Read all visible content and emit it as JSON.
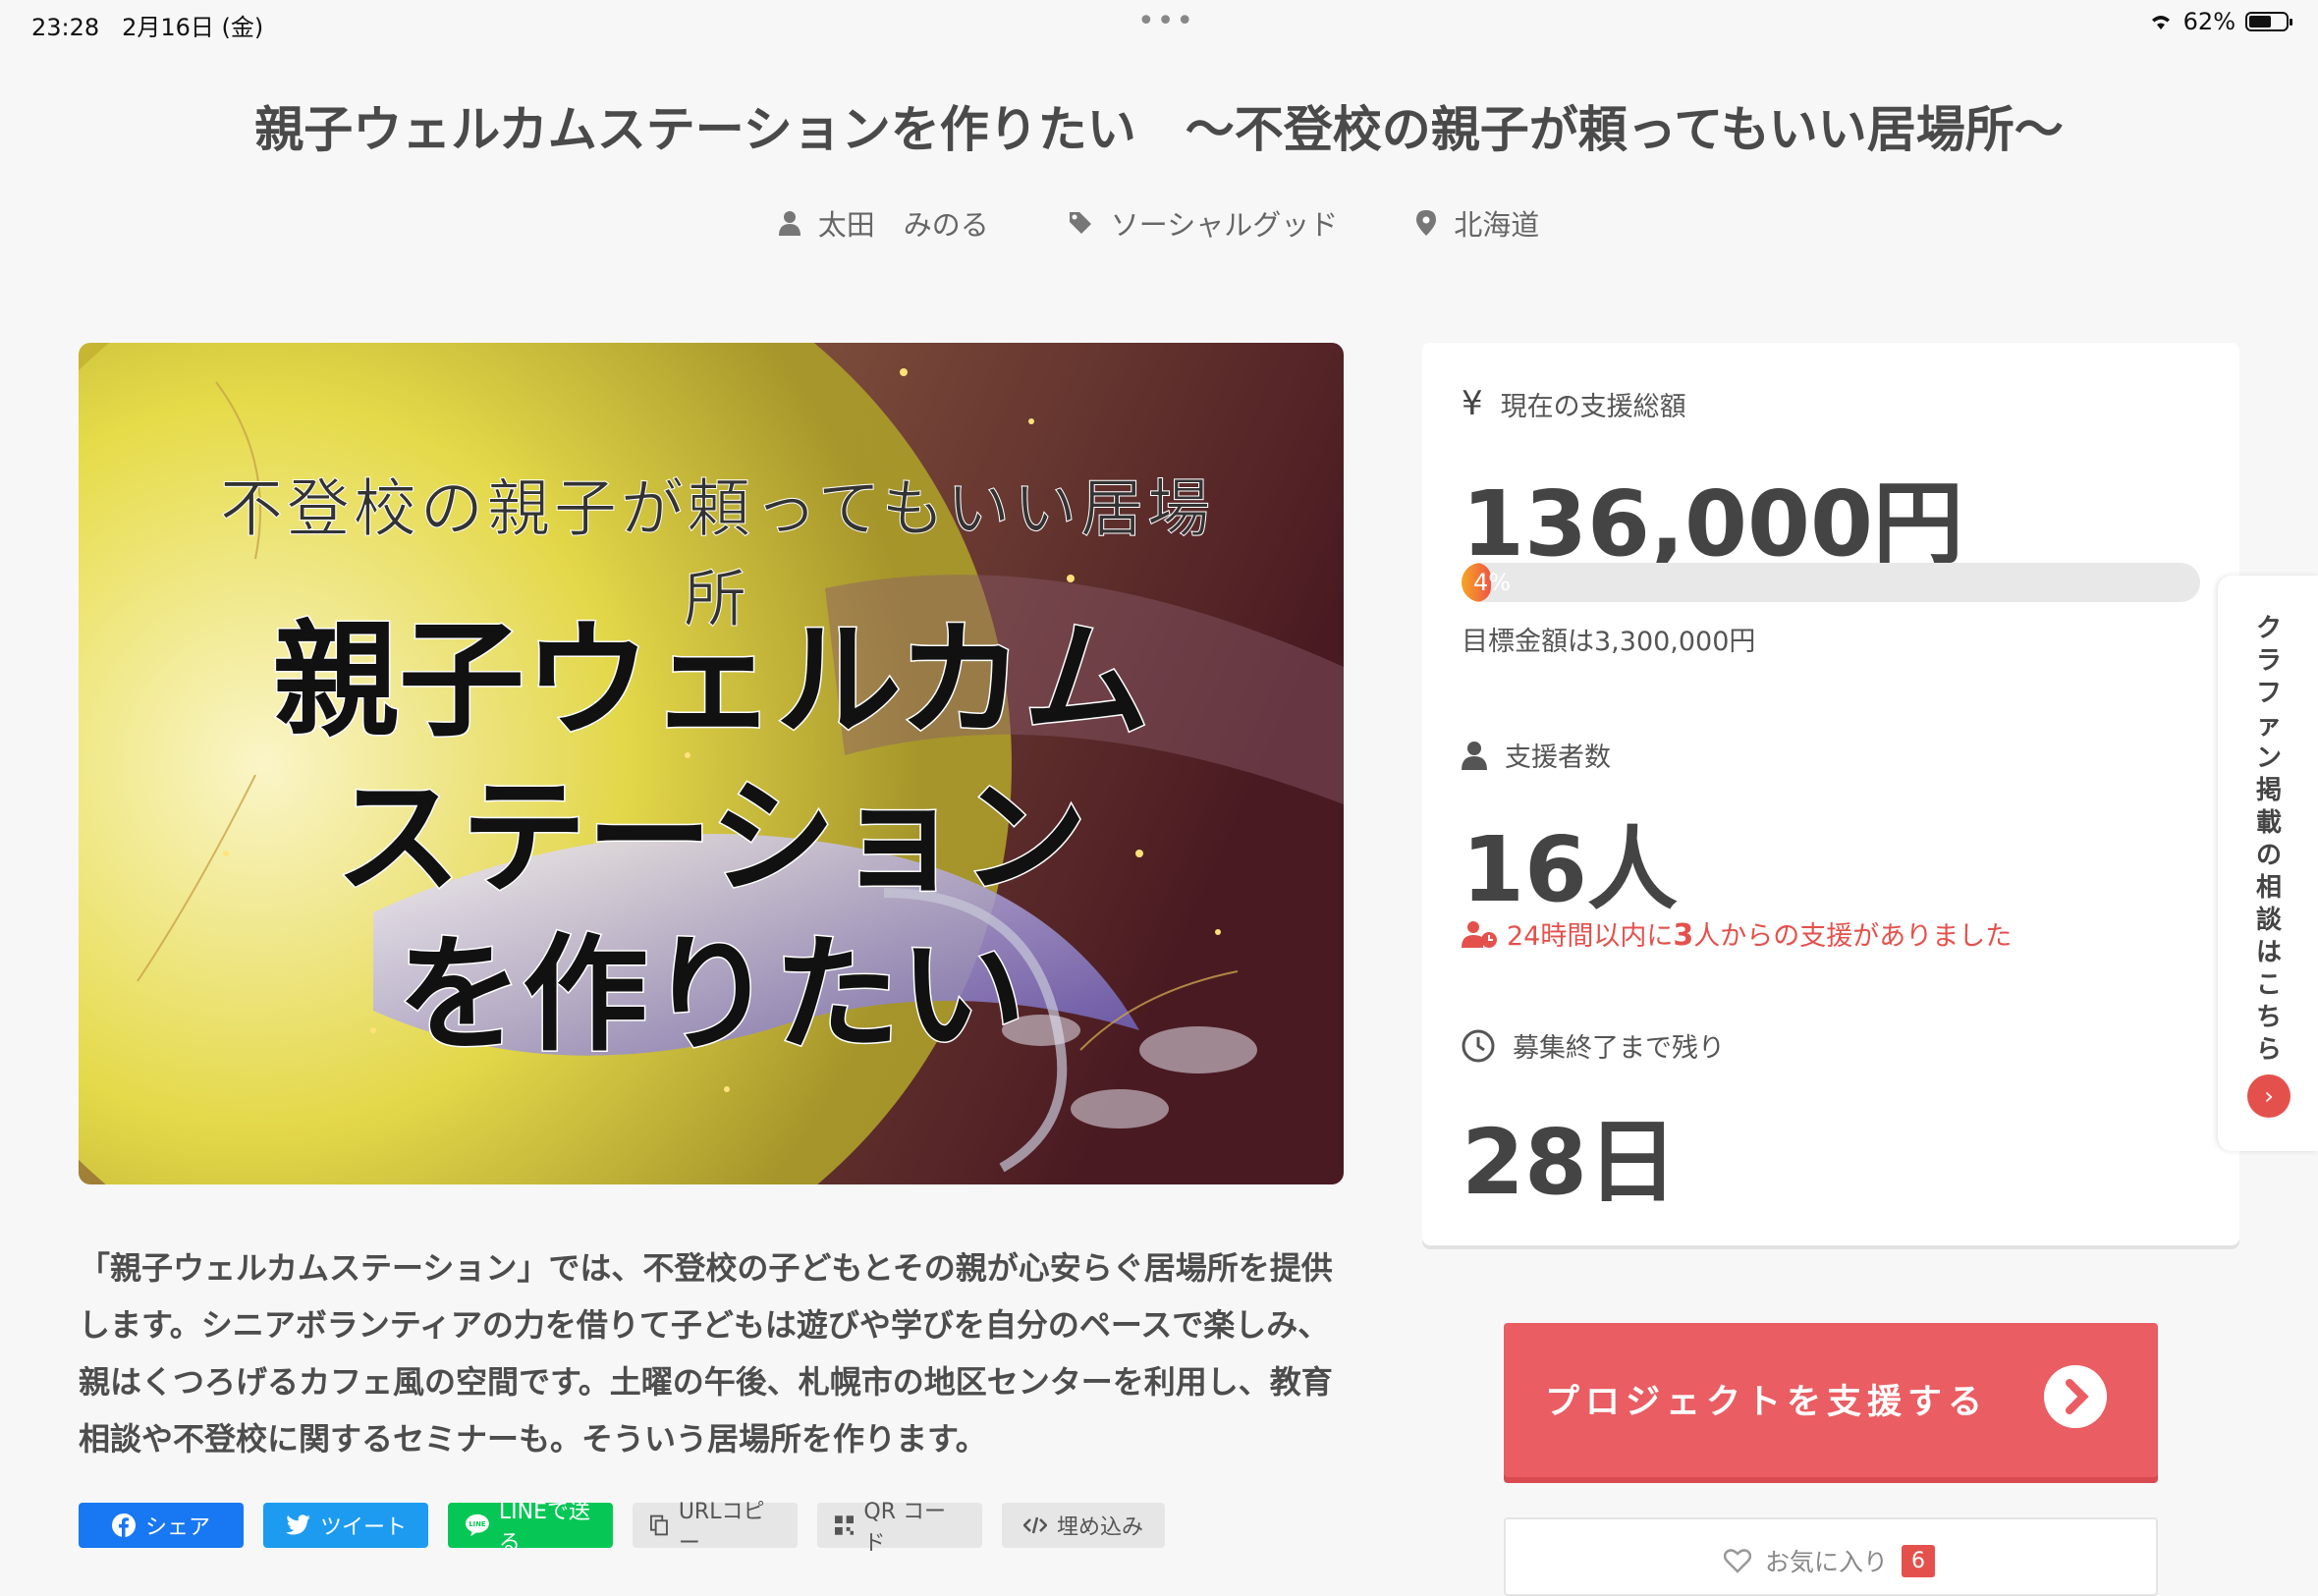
{
  "status": {
    "time": "23:28",
    "date": "2月16日 (金)",
    "battery": "62%",
    "battery_level": 0.62
  },
  "project": {
    "title": "親子ウェルカムステーションを作りたい　～不登校の親子が頼ってもいい居場所～",
    "owner": "太田　みのる",
    "category": "ソーシャルグッド",
    "location": "北海道"
  },
  "hero": {
    "subtitle": "不登校の親子が頼ってもいい居場所",
    "line1": "親子ウェルカム",
    "line2": "ステーション",
    "line3": "を作りたい"
  },
  "description": "「親子ウェルカムステーション」では、不登校の子どもとその親が心安らぐ居場所を提供します。シニアボランティアの力を借りて子どもは遊びや学びを自分のペースで楽しみ、親はくつろげるカフェ風の空間です。土曜の午後、札幌市の地区センターを利用し、教育相談や不登校に関するセミナーも。そういう居場所を作ります。",
  "share": {
    "facebook": "シェア",
    "twitter": "ツイート",
    "line": "LINEで送る",
    "url_copy": "URLコピー",
    "qr": "QR コード",
    "embed": "埋め込み"
  },
  "stats": {
    "amount_label": "現在の支援総額",
    "amount": "136,000円",
    "progress_pct": "4%",
    "progress_value": 0.04,
    "goal": "目標金額は3,300,000円",
    "backers_label": "支援者数",
    "backers": "16人",
    "recent_pre": "24時間以内に",
    "recent_num": "3",
    "recent_post": "人からの支援がありました",
    "remaining_label": "募集終了まで残り",
    "remaining": "28日"
  },
  "support_button": "プロジェクトを支援する",
  "favorite": {
    "label": "お気に入り",
    "count": "6"
  },
  "side_tab": {
    "label": "クラファン掲載の相談はこちら",
    "arrow": "›"
  },
  "colors": {
    "accent": "#ea5d62",
    "alert": "#e4514d",
    "progress_start": "#f5a623"
  }
}
